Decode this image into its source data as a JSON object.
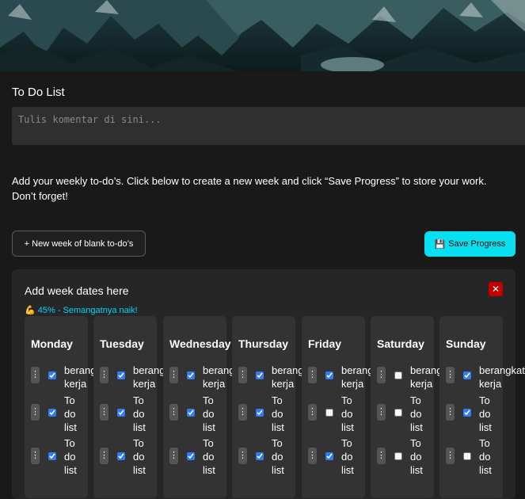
{
  "page": {
    "title": "To Do List",
    "comment_placeholder": "Tulis komentar di sini...",
    "instructions": "Add your weekly to-do’s. Click below to create a new week and click “Save Progress” to store your work. Don’t forget!",
    "new_week_label": "+ New week of blank to-do’s",
    "save_icon": "floppy-disk-icon",
    "save_label": "Save Progress"
  },
  "week": {
    "title": "Add week dates here",
    "close_label": "✕",
    "progress_emoji": "💪",
    "progress_text": "45% - Semangatnya naik!",
    "progress_fraction": 0.45,
    "days": [
      {
        "name": "Monday",
        "tasks": [
          {
            "text": "berangkat kerja",
            "checked": true
          },
          {
            "text": "To do list",
            "checked": true
          },
          {
            "text": "To do list",
            "checked": true
          }
        ]
      },
      {
        "name": "Tuesday",
        "tasks": [
          {
            "text": "berangkat kerja",
            "checked": true
          },
          {
            "text": "To do list",
            "checked": true
          },
          {
            "text": "To do list",
            "checked": true
          }
        ]
      },
      {
        "name": "Wednesday",
        "tasks": [
          {
            "text": "berangkat kerja",
            "checked": true
          },
          {
            "text": "To do list",
            "checked": true
          },
          {
            "text": "To do list",
            "checked": true
          }
        ]
      },
      {
        "name": "Thursday",
        "tasks": [
          {
            "text": "berangkat kerja",
            "checked": true
          },
          {
            "text": "To do list",
            "checked": true
          },
          {
            "text": "To do list",
            "checked": true
          }
        ]
      },
      {
        "name": "Friday",
        "tasks": [
          {
            "text": "berangkat kerja",
            "checked": true
          },
          {
            "text": "To do list",
            "checked": false
          },
          {
            "text": "To do list",
            "checked": true
          }
        ]
      },
      {
        "name": "Saturday",
        "tasks": [
          {
            "text": "berangkat kerja",
            "checked": false
          },
          {
            "text": "To do list",
            "checked": false
          },
          {
            "text": "To do list",
            "checked": false
          }
        ]
      },
      {
        "name": "Sunday",
        "tasks": [
          {
            "text": "berangkat kerja",
            "checked": true
          },
          {
            "text": "To do list",
            "checked": true
          },
          {
            "text": "To do list",
            "checked": false
          }
        ]
      }
    ]
  },
  "colors": {
    "background": "#191919",
    "accent": "#06e0f0",
    "danger": "#c30000",
    "progress_text": "#00d4ff",
    "checkbox": "#2f7cf6"
  }
}
